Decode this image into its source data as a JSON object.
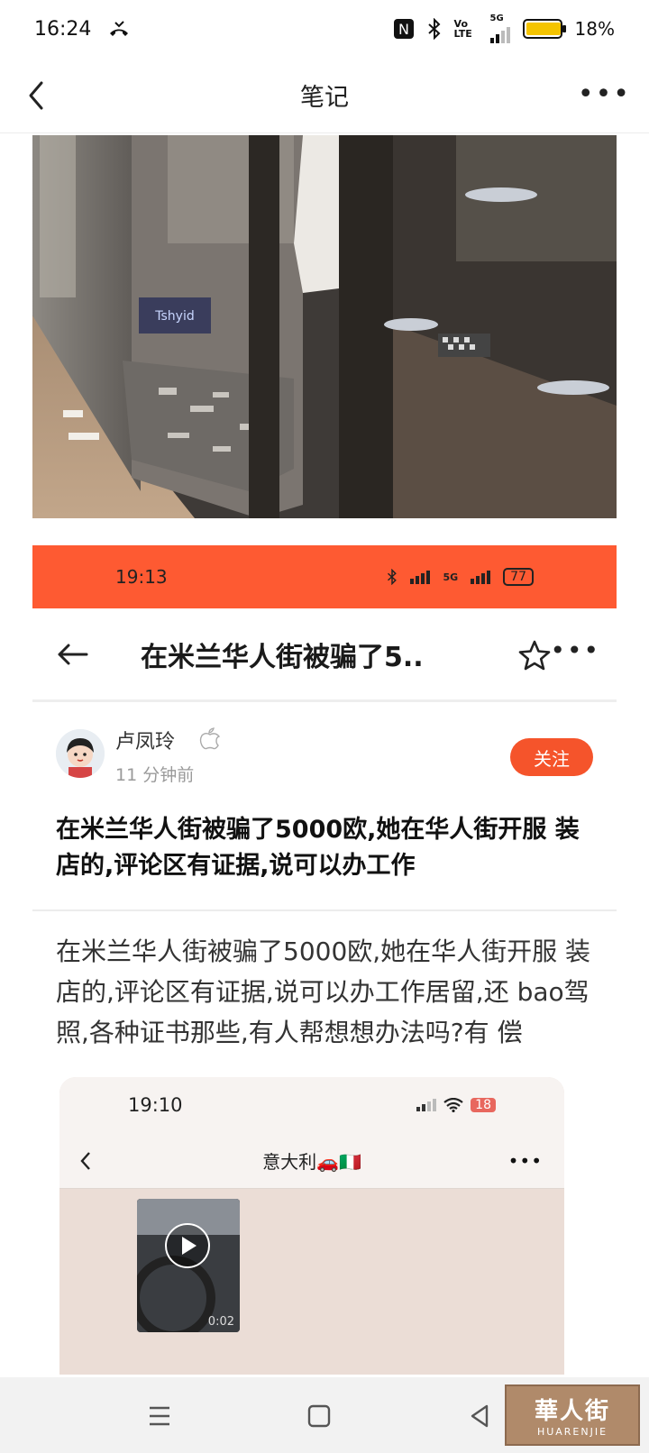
{
  "status_bar": {
    "time": "16:24",
    "nfc": "N",
    "volte": "Vo LTE",
    "network": "5G",
    "battery": "18%",
    "battery_level": 0.18
  },
  "header": {
    "title": "笔记",
    "more": "•••"
  },
  "embedded_screenshot": {
    "status_time": "19:13",
    "status_network": "5G",
    "status_battery": "77",
    "title": "在米兰华人街被骗了5..",
    "more": "•••",
    "author_name": "卢凤玲",
    "post_time": "11 分钟前",
    "follow_label": "关注",
    "post_title": "在米兰华人街被骗了5000欧,她在华人街开服 装店的,评论区有证据,说可以办工作",
    "post_body": "在米兰华人街被骗了5000欧,她在华人街开服 装店的,评论区有证据,说可以办工作居留,还 bao驾照,各种证书那些,有人帮想想办法吗?有 偿",
    "inner_chat": {
      "time": "19:10",
      "battery": "18",
      "title": "意大利🚗🇮🇹",
      "video_duration": "0:02"
    }
  },
  "photo": {
    "sign_text": "Tshyid"
  },
  "bottom_nav": {
    "watermark_main": "華人街",
    "watermark_sub": "HUARENJIE"
  }
}
